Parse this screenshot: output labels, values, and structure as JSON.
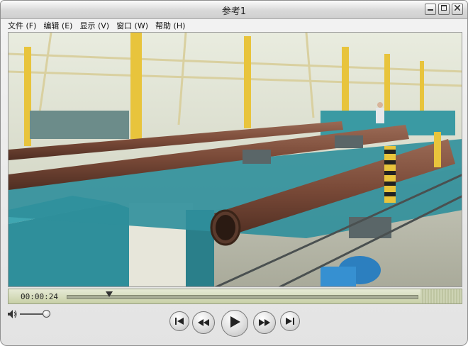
{
  "window": {
    "title": "参考1"
  },
  "menu": [
    {
      "label": "文件 (F)"
    },
    {
      "label": "编辑 (E)"
    },
    {
      "label": "显示 (V)"
    },
    {
      "label": "窗口 (W)"
    },
    {
      "label": "帮助 (H)"
    }
  ],
  "player": {
    "timecode": "00:00:24",
    "progress_fraction": 0.12,
    "volume_fraction": 0.85
  },
  "icons": {
    "minimize": "minimize-icon",
    "maximize": "maximize-icon",
    "close": "close-icon",
    "volume": "speaker-icon",
    "skip_back": "skip-to-start-icon",
    "rewind": "rewind-icon",
    "play": "play-icon",
    "fast_forward": "fast-forward-icon",
    "skip_forward": "skip-to-end-icon"
  },
  "colors": {
    "posbar": "#c8d0a6",
    "machinery": "#2f8f9b",
    "pipe": "#7a4a38",
    "column": "#e8c43c"
  }
}
